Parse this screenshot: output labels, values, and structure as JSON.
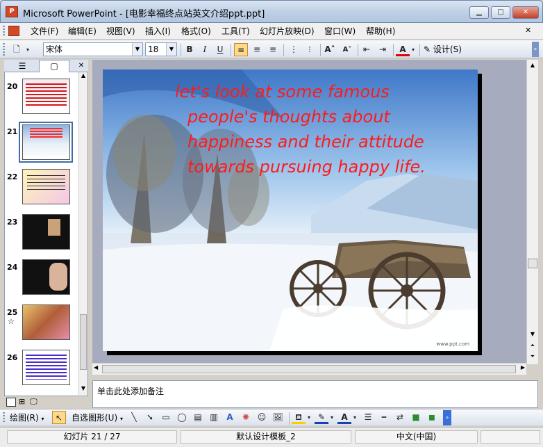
{
  "window": {
    "title": "Microsoft PowerPoint - [电影幸福终点站英文介绍ppt.ppt]",
    "app_icon_label": "P"
  },
  "menu": [
    "文件(F)",
    "编辑(E)",
    "视图(V)",
    "插入(I)",
    "格式(O)",
    "工具(T)",
    "幻灯片放映(D)",
    "窗口(W)",
    "帮助(H)"
  ],
  "format_toolbar": {
    "font_name": "宋体",
    "font_size": "18",
    "design_label": "设计(S)"
  },
  "thumbnails": [
    {
      "number": "20",
      "star": ""
    },
    {
      "number": "21",
      "star": ""
    },
    {
      "number": "22",
      "star": ""
    },
    {
      "number": "23",
      "star": ""
    },
    {
      "number": "24",
      "star": ""
    },
    {
      "number": "25",
      "star": "☆"
    },
    {
      "number": "26",
      "star": ""
    }
  ],
  "slide": {
    "text_line1": "let's look at some famous",
    "text_line2": "people's thoughts about",
    "text_line3": "happiness and their attitude",
    "text_line4": "towards pursuing happy life.",
    "watermark": "www.ppt.com"
  },
  "notes_placeholder": "单击此处添加备注",
  "drawing_toolbar": {
    "draw_label": "绘图(R)",
    "autoshape_label": "自选图形(U)"
  },
  "status": {
    "slide_position": "幻灯片 21 / 27",
    "template": "默认设计模板_2",
    "language": "中文(中国)"
  },
  "colors": {
    "slide_text": "#ff1a1a",
    "titlebar": "#bfd0e6",
    "selected_border": "#3a6ea5"
  }
}
